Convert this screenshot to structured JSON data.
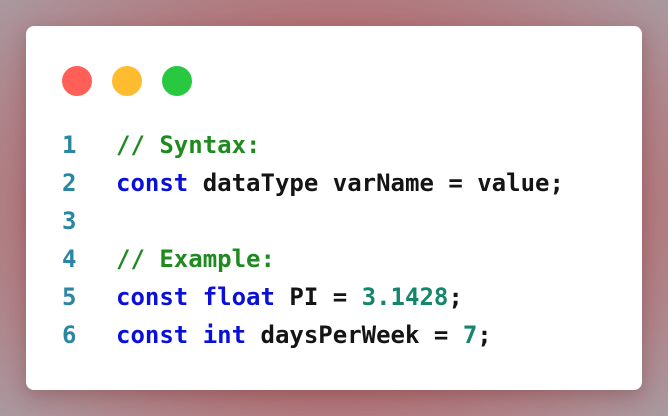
{
  "window": {
    "controls": [
      {
        "name": "close",
        "color": "#ff5f57"
      },
      {
        "name": "minimize",
        "color": "#febc2e"
      },
      {
        "name": "maximize",
        "color": "#28c840"
      }
    ]
  },
  "code_lines": [
    {
      "number": "1",
      "tokens": [
        {
          "text": "// Syntax:",
          "kind": "comment"
        }
      ]
    },
    {
      "number": "2",
      "tokens": [
        {
          "text": "const",
          "kind": "keyword"
        },
        {
          "text": " dataType varName = value;",
          "kind": "plain"
        }
      ]
    },
    {
      "number": "3",
      "tokens": []
    },
    {
      "number": "4",
      "tokens": [
        {
          "text": "// Example:",
          "kind": "comment"
        }
      ]
    },
    {
      "number": "5",
      "tokens": [
        {
          "text": "const",
          "kind": "keyword"
        },
        {
          "text": " ",
          "kind": "plain"
        },
        {
          "text": "float",
          "kind": "keyword"
        },
        {
          "text": " PI = ",
          "kind": "plain"
        },
        {
          "text": "3.1428",
          "kind": "number"
        },
        {
          "text": ";",
          "kind": "plain"
        }
      ]
    },
    {
      "number": "6",
      "tokens": [
        {
          "text": "const",
          "kind": "keyword"
        },
        {
          "text": " ",
          "kind": "plain"
        },
        {
          "text": "int",
          "kind": "keyword"
        },
        {
          "text": " daysPerWeek = ",
          "kind": "plain"
        },
        {
          "text": "7",
          "kind": "number"
        },
        {
          "text": ";",
          "kind": "plain"
        }
      ]
    }
  ],
  "colors": {
    "line_number": "#2a86a3",
    "comment": "#1f8a1f",
    "keyword": "#0a10d8",
    "plain": "#141414",
    "number": "#15866b"
  }
}
